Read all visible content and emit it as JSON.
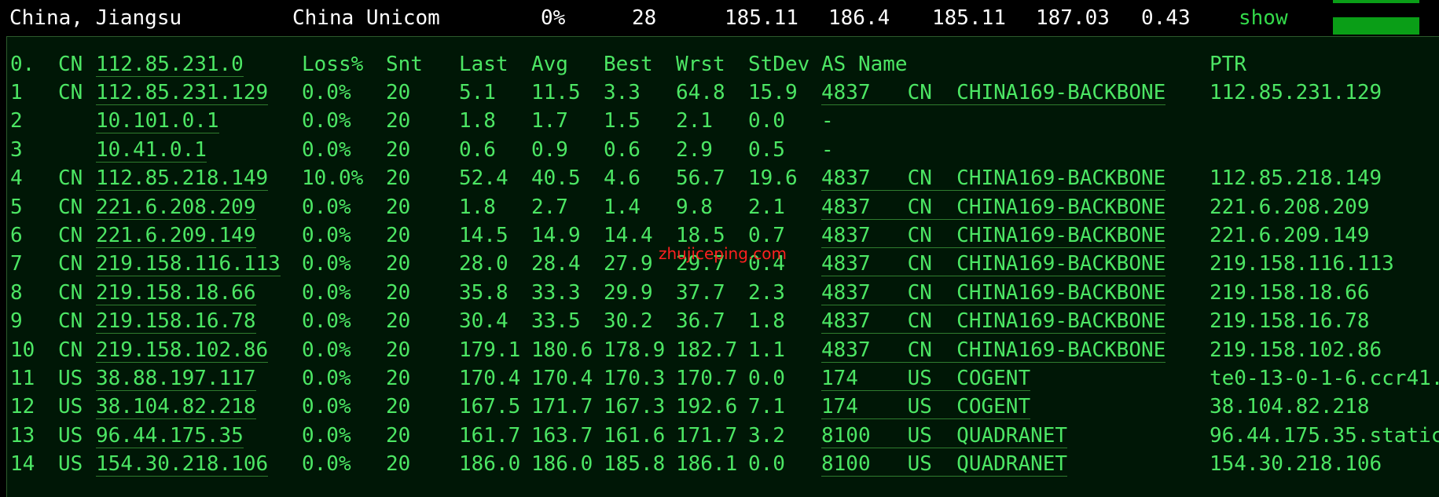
{
  "summary": {
    "location": "China, Jiangsu",
    "isp": "China Unicom",
    "loss": "0%",
    "sent": "28",
    "last": "185.11",
    "avg": "186.4",
    "best": "185.11",
    "worst": "187.03",
    "stdev": "0.43",
    "show_label": "show",
    "accent": "#0a9e17"
  },
  "table": {
    "header": {
      "hop": "0.",
      "cc": "CN",
      "host": "112.85.231.0",
      "loss": "Loss%",
      "snt": "Snt",
      "last": "Last",
      "avg": "Avg",
      "best": "Best",
      "wrst": "Wrst",
      "stdev": "StDev",
      "as_name": "AS Name",
      "ptr": "PTR"
    },
    "rows": [
      {
        "hop": "1",
        "cc": "CN",
        "host": "112.85.231.129",
        "loss": "0.0%",
        "snt": "20",
        "last": "5.1",
        "avg": "11.5",
        "best": "3.3",
        "wrst": "64.8",
        "stdev": "15.9",
        "as": "4837   CN  CHINA169-BACKBONE",
        "ptr": "112.85.231.129"
      },
      {
        "hop": "2",
        "cc": "",
        "host": "10.101.0.1",
        "loss": "0.0%",
        "snt": "20",
        "last": "1.8",
        "avg": "1.7",
        "best": "1.5",
        "wrst": "2.1",
        "stdev": "0.0",
        "as": "-",
        "ptr": ""
      },
      {
        "hop": "3",
        "cc": "",
        "host": "10.41.0.1",
        "loss": "0.0%",
        "snt": "20",
        "last": "0.6",
        "avg": "0.9",
        "best": "0.6",
        "wrst": "2.9",
        "stdev": "0.5",
        "as": "-",
        "ptr": ""
      },
      {
        "hop": "4",
        "cc": "CN",
        "host": "112.85.218.149",
        "loss": "10.0%",
        "snt": "20",
        "last": "52.4",
        "avg": "40.5",
        "best": "4.6",
        "wrst": "56.7",
        "stdev": "19.6",
        "as": "4837   CN  CHINA169-BACKBONE",
        "ptr": "112.85.218.149"
      },
      {
        "hop": "5",
        "cc": "CN",
        "host": "221.6.208.209",
        "loss": "0.0%",
        "snt": "20",
        "last": "1.8",
        "avg": "2.7",
        "best": "1.4",
        "wrst": "9.8",
        "stdev": "2.1",
        "as": "4837   CN  CHINA169-BACKBONE",
        "ptr": "221.6.208.209"
      },
      {
        "hop": "6",
        "cc": "CN",
        "host": "221.6.209.149",
        "loss": "0.0%",
        "snt": "20",
        "last": "14.5",
        "avg": "14.9",
        "best": "14.4",
        "wrst": "18.5",
        "stdev": "0.7",
        "as": "4837   CN  CHINA169-BACKBONE",
        "ptr": "221.6.209.149"
      },
      {
        "hop": "7",
        "cc": "CN",
        "host": "219.158.116.113",
        "loss": "0.0%",
        "snt": "20",
        "last": "28.0",
        "avg": "28.4",
        "best": "27.9",
        "wrst": "29.7",
        "stdev": "0.4",
        "as": "4837   CN  CHINA169-BACKBONE",
        "ptr": "219.158.116.113"
      },
      {
        "hop": "8",
        "cc": "CN",
        "host": "219.158.18.66",
        "loss": "0.0%",
        "snt": "20",
        "last": "35.8",
        "avg": "33.3",
        "best": "29.9",
        "wrst": "37.7",
        "stdev": "2.3",
        "as": "4837   CN  CHINA169-BACKBONE",
        "ptr": "219.158.18.66"
      },
      {
        "hop": "9",
        "cc": "CN",
        "host": "219.158.16.78",
        "loss": "0.0%",
        "snt": "20",
        "last": "30.4",
        "avg": "33.5",
        "best": "30.2",
        "wrst": "36.7",
        "stdev": "1.8",
        "as": "4837   CN  CHINA169-BACKBONE",
        "ptr": "219.158.16.78"
      },
      {
        "hop": "10",
        "cc": "CN",
        "host": "219.158.102.86",
        "loss": "0.0%",
        "snt": "20",
        "last": "179.1",
        "avg": "180.6",
        "best": "178.9",
        "wrst": "182.7",
        "stdev": "1.1",
        "as": "4837   CN  CHINA169-BACKBONE",
        "ptr": "219.158.102.86"
      },
      {
        "hop": "11",
        "cc": "US",
        "host": "38.88.197.117",
        "loss": "0.0%",
        "snt": "20",
        "last": "170.4",
        "avg": "170.4",
        "best": "170.3",
        "wrst": "170.7",
        "stdev": "0.0",
        "as": "174    US  COGENT",
        "ptr": "te0-13-0-1-6.ccr41."
      },
      {
        "hop": "12",
        "cc": "US",
        "host": "38.104.82.218",
        "loss": "0.0%",
        "snt": "20",
        "last": "167.5",
        "avg": "171.7",
        "best": "167.3",
        "wrst": "192.6",
        "stdev": "7.1",
        "as": "174    US  COGENT",
        "ptr": "38.104.82.218"
      },
      {
        "hop": "13",
        "cc": "US",
        "host": "96.44.175.35",
        "loss": "0.0%",
        "snt": "20",
        "last": "161.7",
        "avg": "163.7",
        "best": "161.6",
        "wrst": "171.7",
        "stdev": "3.2",
        "as": "8100   US  QUADRANET",
        "ptr": "96.44.175.35.static"
      },
      {
        "hop": "14",
        "cc": "US",
        "host": "154.30.218.106",
        "loss": "0.0%",
        "snt": "20",
        "last": "186.0",
        "avg": "186.0",
        "best": "185.8",
        "wrst": "186.1",
        "stdev": "0.0",
        "as": "8100   US  QUADRANET",
        "ptr": "154.30.218.106"
      }
    ]
  },
  "watermark": "zhujiceping.com"
}
